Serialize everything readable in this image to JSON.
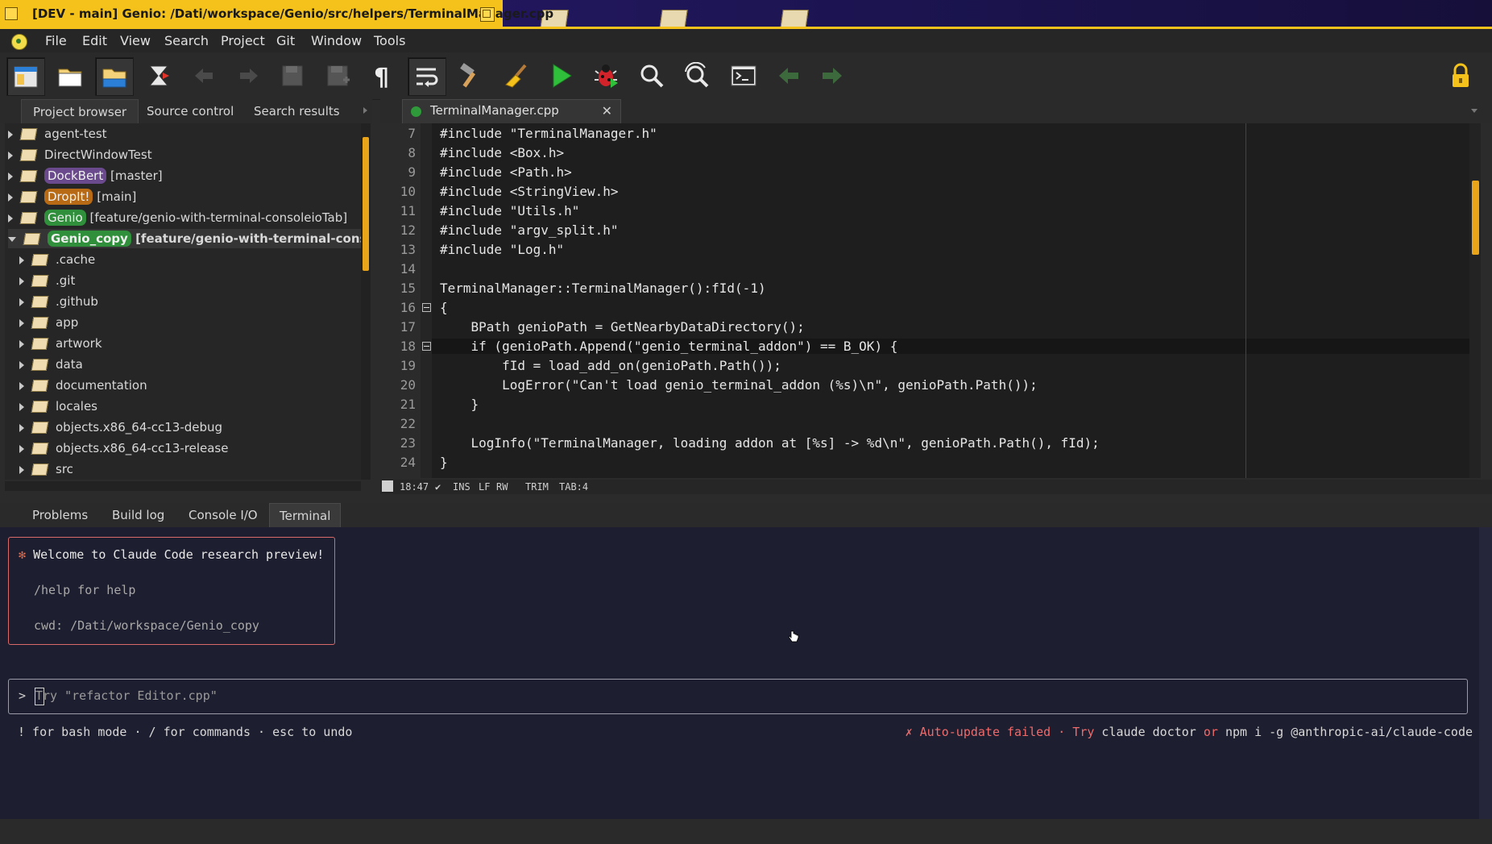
{
  "window": {
    "title": "[DEV - main] Genio: /Dati/workspace/Genio/src/helpers/TerminalManager.cpp"
  },
  "menu": [
    "File",
    "Edit",
    "View",
    "Search",
    "Project",
    "Git",
    "Window",
    "Tools"
  ],
  "toolbar_icons": [
    "project-browser-icon",
    "open-folder-icon",
    "save-panel-icon",
    "build-target-icon",
    "undo-icon",
    "redo-icon",
    "save-icon",
    "save-all-icon",
    "pilcrow-icon",
    "wrap-icon",
    "build-hammer-icon",
    "clean-broom-icon",
    "run-icon",
    "debug-bug-icon",
    "find-icon",
    "find-replace-icon",
    "terminal-icon",
    "back-arrow-icon",
    "forward-arrow-icon",
    "lock-icon"
  ],
  "left_panel": {
    "tabs": [
      "Project browser",
      "Source control",
      "Search results"
    ],
    "projects": [
      {
        "name": "agent-test",
        "branch": "",
        "pill": ""
      },
      {
        "name": "DirectWindowTest",
        "branch": "",
        "pill": ""
      },
      {
        "name": "DockBert",
        "branch": "[master]",
        "pill": "#6a4a8c"
      },
      {
        "name": "DropIt!",
        "branch": "[main]",
        "pill": "#b86a14"
      },
      {
        "name": "Genio",
        "branch": "[feature/genio-with-terminal-consoleioTab]",
        "pill": "#2f8f3a"
      },
      {
        "name": "Genio_copy",
        "branch": "[feature/genio-with-terminal-consoleioT",
        "pill": "#2f8f3a"
      }
    ],
    "folders": [
      ".cache",
      ".git",
      ".github",
      "app",
      "artwork",
      "data",
      "documentation",
      "locales",
      "objects.x86_64-cc13-debug",
      "objects.x86_64-cc13-release",
      "src"
    ]
  },
  "editor": {
    "tab_label": "TerminalManager.cpp",
    "line_numbers": [
      "7",
      "8",
      "9",
      "10",
      "11",
      "12",
      "13",
      "14",
      "15",
      "16",
      "17",
      "18",
      "19",
      "20",
      "21",
      "22",
      "23",
      "24"
    ],
    "lines": [
      "#include \"TerminalManager.h\"",
      "#include <Box.h>",
      "#include <Path.h>",
      "#include <StringView.h>",
      "#include \"Utils.h\"",
      "#include \"argv_split.h\"",
      "#include \"Log.h\"",
      "",
      "TerminalManager::TerminalManager():fId(-1)",
      "{",
      "    BPath genioPath = GetNearbyDataDirectory();",
      "    if (genioPath.Append(\"genio_terminal_addon\") == B_OK) {",
      "        fId = load_add_on(genioPath.Path());",
      "        LogError(\"Can't load genio_terminal_addon (%s)\\n\", genioPath.Path());",
      "    }",
      "",
      "    LogInfo(\"TerminalManager, loading addon at [%s] -> %d\\n\", genioPath.Path(), fId);",
      "}"
    ],
    "status": {
      "position": "18:47",
      "check": "✔",
      "ins": "INS",
      "lf": "LF",
      "rw": "RW",
      "trim": "TRIM",
      "tab": "TAB:4"
    }
  },
  "bottom_panel": {
    "tabs": [
      "Problems",
      "Build log",
      "Console I/O",
      "Terminal"
    ],
    "terminal": {
      "welcome_star": "✻",
      "welcome": "Welcome to Claude Code research preview!",
      "help": "/help for help",
      "cwd": "cwd: /Dati/workspace/Genio_copy",
      "prompt_symbol": ">",
      "placeholder": "Try \"refactor Editor.cpp\"",
      "hint": "! for bash mode · / for commands · esc to undo",
      "warn_prefix": "✗ Auto-update failed · Try ",
      "warn_cmd1": "claude doctor",
      "warn_or": " or ",
      "warn_cmd2": "npm i -g @anthropic-ai/claude-code"
    }
  },
  "colors": {
    "accent_yellow": "#f4c21a",
    "terminal_bg": "#1d1e2f",
    "error_red": "#f06a6a",
    "keyword_blue": "#4fb3ff",
    "string_yellow": "#d8c84a"
  }
}
